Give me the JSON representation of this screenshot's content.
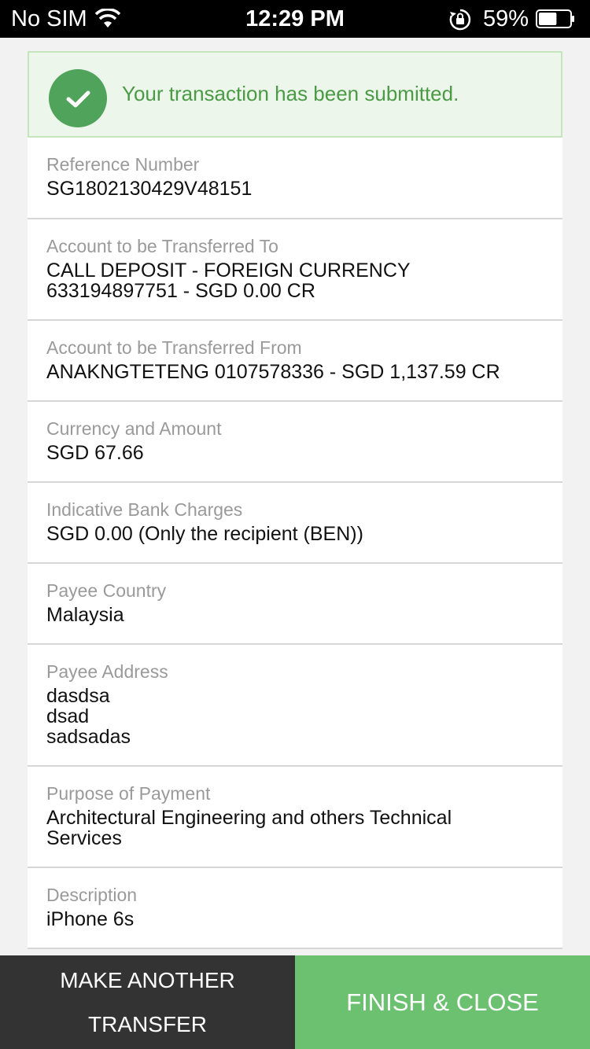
{
  "status_bar": {
    "carrier": "No SIM",
    "time": "12:29 PM",
    "battery_percent": "59%",
    "battery_level": 0.59,
    "icons": [
      "wifi-icon",
      "rotation-lock-icon",
      "battery-icon"
    ]
  },
  "banner": {
    "message": "Your transaction has been submitted.",
    "icon": "check-icon",
    "color": "#4a9a46"
  },
  "fields": {
    "reference": {
      "label": "Reference Number",
      "value": "SG1802130429V48151"
    },
    "to_account": {
      "label": "Account to be Transferred To",
      "value": "CALL DEPOSIT - FOREIGN CURRENCY\n633194897751 - SGD 0.00 CR"
    },
    "from_account": {
      "label": "Account to be Transferred From",
      "value": "ANAKNGTETENG 0107578336 - SGD 1,137.59 CR"
    },
    "amount": {
      "label": "Currency and Amount",
      "value": "SGD 67.66"
    },
    "charges": {
      "label": "Indicative Bank Charges",
      "value": "SGD 0.00 (Only the recipient (BEN))"
    },
    "payee_country": {
      "label": "Payee Country",
      "value": "Malaysia"
    },
    "payee_address": {
      "label": "Payee Address",
      "value": "dasdsa\ndsad\nsadsadas"
    },
    "purpose": {
      "label": "Purpose of Payment",
      "value": "Architectural Engineering and others Technical\nServices"
    },
    "description": {
      "label": "Description",
      "value": "iPhone 6s"
    }
  },
  "actions": {
    "make_another_line1": "MAKE ANOTHER",
    "make_another_line2": "TRANSFER",
    "finish": "FINISH & CLOSE"
  },
  "colors": {
    "finish_button": "#6cc170",
    "another_button": "#333333"
  }
}
